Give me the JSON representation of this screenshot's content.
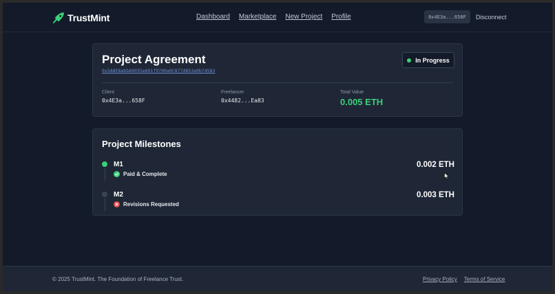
{
  "brand": {
    "name": "TrustMint",
    "accent": "#3ad07a",
    "logo_icon": "rocket-logo-icon"
  },
  "nav": {
    "items": [
      "Dashboard",
      "Marketplace",
      "New Project",
      "Profile"
    ]
  },
  "wallet": {
    "address_short": "0x4E3a...658F",
    "disconnect_label": "Disconnect"
  },
  "agreement": {
    "title": "Project Agreement",
    "contract_address": "0x5A8E8abbA9035e601f9700a0C877d853a0b74583",
    "status": "In Progress",
    "status_color": "#3ad07a",
    "client_label": "Client",
    "client_value": "0x4E3a...658F",
    "freelancer_label": "Freelancer",
    "freelancer_value": "0x4482...Ea83",
    "total_label": "Total Value",
    "total_value": "0.005 ETH"
  },
  "milestones": {
    "title": "Project Milestones",
    "items": [
      {
        "name": "M1",
        "status": "Paid & Complete",
        "status_icon": "check-circle-icon",
        "status_color": "#3ad07a",
        "amount": "0.002 ETH",
        "dot_color": "#3ad07a"
      },
      {
        "name": "M2",
        "status": "Revisions Requested",
        "status_icon": "x-circle-icon",
        "status_color": "#e5484d",
        "amount": "0.003 ETH",
        "dot_color": "#3a4456"
      }
    ]
  },
  "footer": {
    "copyright": "© 2025 TrustMint. The Foundation of Freelance Trust.",
    "links": [
      "Privacy Policy",
      "Terms of Service"
    ]
  }
}
